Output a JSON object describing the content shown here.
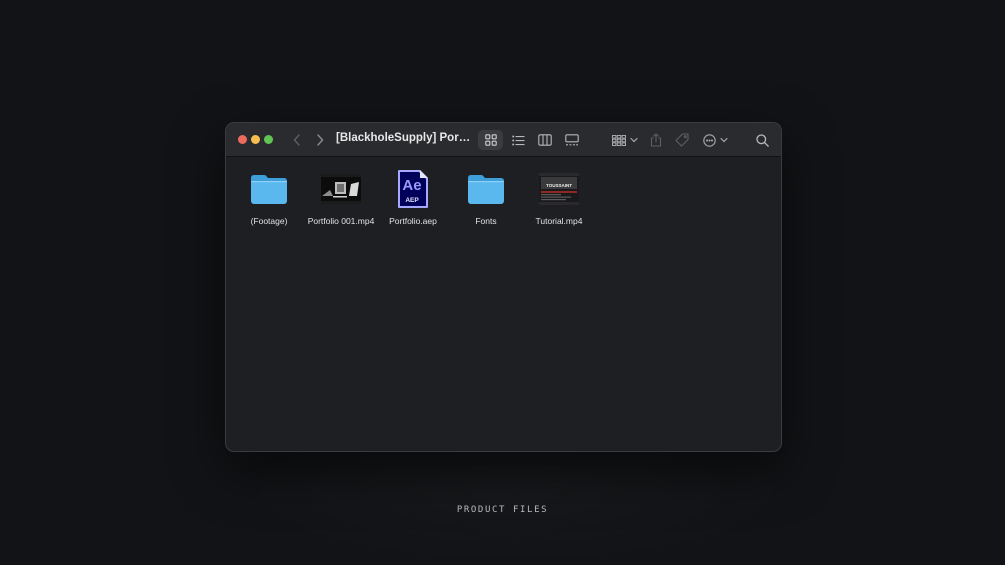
{
  "window": {
    "title": "[BlackholeSupply] Portfolio...",
    "traffic_lights": {
      "close_color": "#ed6a5e",
      "minimize_color": "#f5bf4f",
      "zoom_color": "#61c454"
    },
    "toolbar": {
      "view_modes": [
        "icon-view-icon",
        "list-view-icon",
        "column-view-icon",
        "gallery-view-icon"
      ],
      "selected_view": "icon-view-icon",
      "actions": [
        "group-by-icon",
        "share-icon",
        "tag-icon",
        "more-actions-icon",
        "search-icon"
      ]
    }
  },
  "files": [
    {
      "name": "(Footage)",
      "kind": "folder-icon"
    },
    {
      "name": "Portfolio 001.mp4",
      "kind": "video-thumbnail"
    },
    {
      "name": "Portfolio.aep",
      "kind": "after-effects-icon",
      "badge_text": "Ae",
      "badge_ext": "AEP"
    },
    {
      "name": "Fonts",
      "kind": "folder-icon"
    },
    {
      "name": "Tutorial.mp4",
      "kind": "video-thumbnail",
      "thumb_text": "TOUSSAINT"
    }
  ],
  "caption": "PRODUCT FILES"
}
